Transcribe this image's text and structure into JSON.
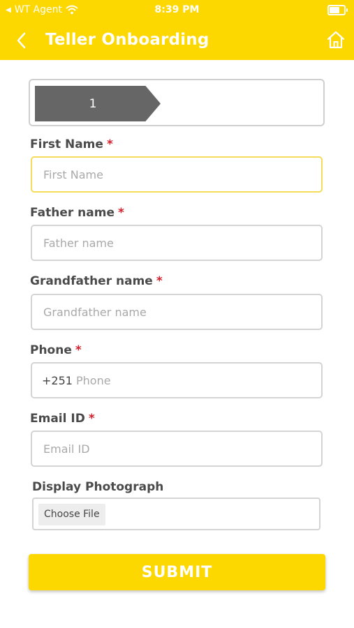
{
  "status_bar": {
    "carrier": "WT Agent",
    "time": "8:39 PM"
  },
  "header": {
    "title": "Teller Onboarding"
  },
  "stepper": {
    "current_step": "1"
  },
  "colors": {
    "brand_yellow": "#FCD800",
    "required_red": "#D21F2C",
    "step_gray": "#666666"
  },
  "form": {
    "first_name": {
      "label": "First Name",
      "required_mark": "*",
      "placeholder": "First Name"
    },
    "father_name": {
      "label": "Father name",
      "required_mark": "*",
      "placeholder": "Father name"
    },
    "grandfather_name": {
      "label": "Grandfather name",
      "required_mark": "*",
      "placeholder": "Grandfather name"
    },
    "phone": {
      "label": "Phone",
      "required_mark": "*",
      "prefix": "+251",
      "placeholder": "Phone"
    },
    "email": {
      "label": "Email ID",
      "required_mark": "*",
      "placeholder": "Email ID"
    },
    "photo": {
      "label": "Display Photograph",
      "button_label": "Choose File"
    }
  },
  "submit": {
    "label": "SUBMIT"
  },
  "icons": {
    "back": "chevron-left-icon",
    "home": "home-icon",
    "wifi": "wifi-icon",
    "battery": "battery-icon"
  }
}
